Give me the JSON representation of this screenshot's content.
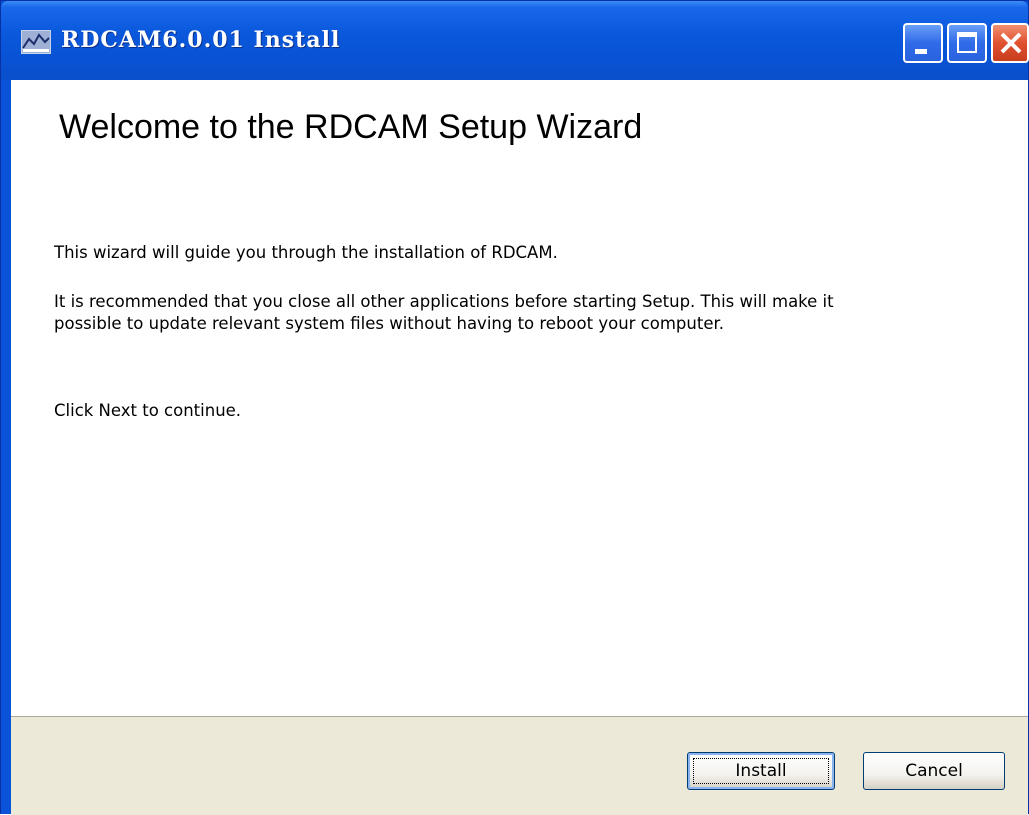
{
  "window": {
    "title": "RDCAM6.0.01 Install",
    "controls": {
      "minimize_icon": "minimize-icon",
      "maximize_icon": "maximize-icon",
      "close_icon": "close-icon"
    },
    "colors": {
      "titlebar": "#0a58dc",
      "close_button": "#e0512f",
      "footer": "#ece9d8"
    }
  },
  "page": {
    "heading": "Welcome to the RDCAM Setup Wizard",
    "paragraphs": [
      "This wizard will guide you through the installation of RDCAM.",
      "It is recommended that you close all other applications before starting Setup. This will make it possible to update relevant system files without having to reboot your computer.",
      "Click Next to continue."
    ]
  },
  "footer": {
    "install_label": "Install",
    "cancel_label": "Cancel"
  }
}
